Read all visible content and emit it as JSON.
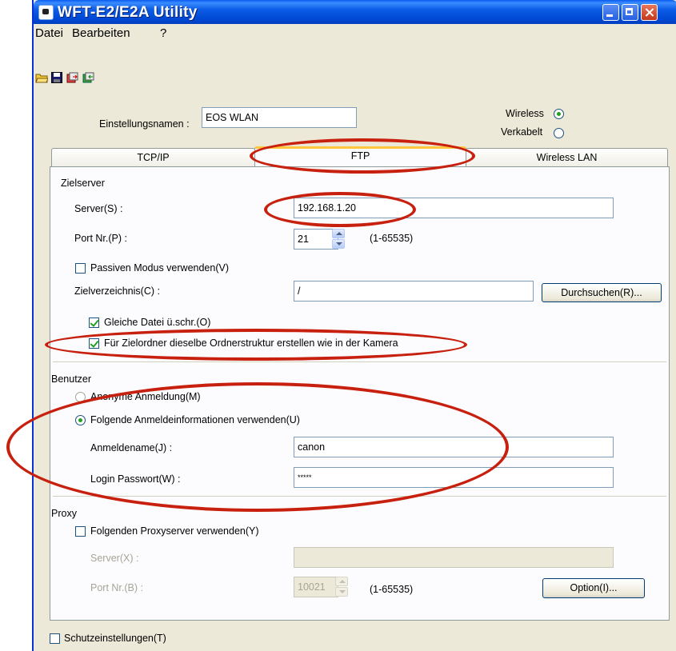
{
  "window": {
    "title": "WFT-E2/E2A Utility"
  },
  "menu": [
    "Datei",
    "Bearbeiten",
    "?"
  ],
  "toolbar": [
    "open-folder-icon",
    "save-icon",
    "export-icon",
    "import-icon"
  ],
  "header": {
    "settings_name_label": "Einstellungsnamen :",
    "settings_name_value": "EOS WLAN",
    "wireless_label": "Wireless",
    "wired_label": "Verkabelt"
  },
  "tabs": [
    "TCP/IP",
    "FTP",
    "Wireless LAN"
  ],
  "target_server": {
    "group_label": "Zielserver",
    "server_label": "Server(S) :",
    "server_value": "192.168.1.20",
    "port_label": "Port Nr.(P) :",
    "port_value": "21",
    "port_range": "(1-65535)",
    "passive_label": "Passiven Modus verwenden(V)",
    "dir_label": "Zielverzeichnis(C) :",
    "dir_value": "/",
    "browse_button": "Durchsuchen(R)...",
    "overwrite_label": "Gleiche Datei ü.schr.(O)",
    "structure_label": "Für Zielordner dieselbe Ordnerstruktur erstellen wie in der Kamera"
  },
  "user": {
    "group_label": "Benutzer",
    "anon_label": "Anonyme Anmeldung(M)",
    "login_info_label": "Folgende Anmeldeinformationen verwenden(U)",
    "login_name_label": "Anmeldename(J) :",
    "login_name_value": "canon",
    "password_label": "Login Passwort(W) :",
    "password_value": "*****"
  },
  "proxy": {
    "group_label": "Proxy",
    "use_proxy_label": "Folgenden Proxyserver verwenden(Y)",
    "server_label": "Server(X) :",
    "server_value": "",
    "port_label": "Port Nr.(B) :",
    "port_value": "10021",
    "port_range": "(1-65535)",
    "option_button": "Option(I)..."
  },
  "footer": {
    "protection_label": "Schutzeinstellungen(T)"
  },
  "colors": {
    "annotation": "#c8200e",
    "title_bar": "#0048d4",
    "tab_highlight": "#ffc83c"
  }
}
